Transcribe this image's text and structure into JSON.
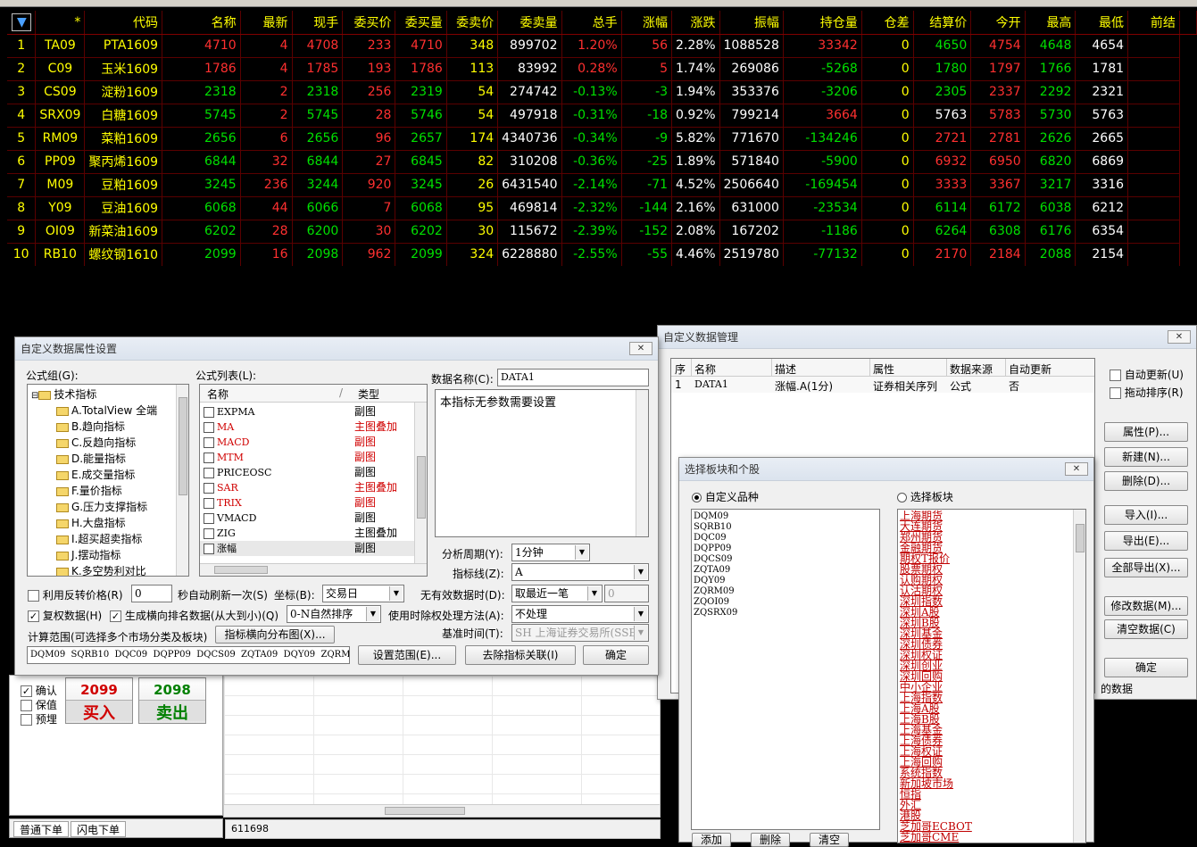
{
  "market": {
    "headers": [
      "*",
      "代码",
      "名称",
      "最新",
      "现手",
      "委买价",
      "委买量",
      "委卖价",
      "委卖量",
      "总手",
      "涨幅",
      "涨跌",
      "振幅",
      "持仓量",
      "仓差",
      "结算价",
      "今开",
      "最高",
      "最低",
      "前结"
    ],
    "sort_icon": "sort-arrow-icon",
    "rows": [
      [
        "1",
        "TA09",
        "PTA1609",
        "4710",
        "4",
        "4708",
        "233",
        "4710",
        "348",
        "899702",
        "1.20%",
        "56",
        "2.28%",
        "1088528",
        "33342",
        "0",
        "4650",
        "4754",
        "4648",
        "4654"
      ],
      [
        "2",
        "C09",
        "玉米1609",
        "1786",
        "4",
        "1785",
        "193",
        "1786",
        "113",
        "83992",
        "0.28%",
        "5",
        "1.74%",
        "269086",
        "-5268",
        "0",
        "1780",
        "1797",
        "1766",
        "1781"
      ],
      [
        "3",
        "CS09",
        "淀粉1609",
        "2318",
        "2",
        "2318",
        "256",
        "2319",
        "54",
        "274742",
        "-0.13%",
        "-3",
        "1.94%",
        "353376",
        "-3206",
        "0",
        "2305",
        "2337",
        "2292",
        "2321"
      ],
      [
        "4",
        "SRX09",
        "白糖1609",
        "5745",
        "2",
        "5745",
        "28",
        "5746",
        "54",
        "497918",
        "-0.31%",
        "-18",
        "0.92%",
        "799214",
        "3664",
        "0",
        "5763",
        "5783",
        "5730",
        "5763"
      ],
      [
        "5",
        "RM09",
        "菜粕1609",
        "2656",
        "6",
        "2656",
        "96",
        "2657",
        "174",
        "4340736",
        "-0.34%",
        "-9",
        "5.82%",
        "771670",
        "-134246",
        "0",
        "2721",
        "2781",
        "2626",
        "2665"
      ],
      [
        "6",
        "PP09",
        "聚丙烯1609",
        "6844",
        "32",
        "6844",
        "27",
        "6845",
        "82",
        "310208",
        "-0.36%",
        "-25",
        "1.89%",
        "571840",
        "-5900",
        "0",
        "6932",
        "6950",
        "6820",
        "6869"
      ],
      [
        "7",
        "M09",
        "豆粕1609",
        "3245",
        "236",
        "3244",
        "920",
        "3245",
        "26",
        "6431540",
        "-2.14%",
        "-71",
        "4.52%",
        "2506640",
        "-169454",
        "0",
        "3333",
        "3367",
        "3217",
        "3316"
      ],
      [
        "8",
        "Y09",
        "豆油1609",
        "6068",
        "44",
        "6066",
        "7",
        "6068",
        "95",
        "469814",
        "-2.32%",
        "-144",
        "2.16%",
        "631000",
        "-23534",
        "0",
        "6114",
        "6172",
        "6038",
        "6212"
      ],
      [
        "9",
        "OI09",
        "新菜油1609",
        "6202",
        "28",
        "6200",
        "30",
        "6202",
        "30",
        "115672",
        "-2.39%",
        "-152",
        "2.08%",
        "167202",
        "-1186",
        "0",
        "6264",
        "6308",
        "6176",
        "6354"
      ],
      [
        "10",
        "RB10",
        "螺纹钢1610",
        "2099",
        "16",
        "2098",
        "962",
        "2099",
        "324",
        "6228880",
        "-2.55%",
        "-55",
        "4.46%",
        "2519780",
        "-77132",
        "0",
        "2170",
        "2184",
        "2088",
        "2154"
      ]
    ]
  },
  "order": {
    "confirm": "确认",
    "hedge": "保值",
    "preorder": "预埋",
    "buy_price": "2099",
    "buy_label": "买入",
    "sell_price": "2098",
    "sell_label": "卖出",
    "tab_normal": "普通下单",
    "tab_flash": "闪电下单",
    "status_value": "611698"
  },
  "prop_dialog": {
    "title": "自定义数据属性设置",
    "group_label": "公式组(G):",
    "list_label": "公式列表(L):",
    "name_label": "数据名称(C):",
    "name_value": "DATA1",
    "desc": "本指标无参数需要设置",
    "tree_root": "技术指标",
    "tree": [
      "A.TotalView 全端",
      "B.趋向指标",
      "C.反趋向指标",
      "D.能量指标",
      "E.成交量指标",
      "F.量价指标",
      "G.压力支撑指标",
      "H.大盘指标",
      "I.超买超卖指标",
      "J.摆动指标",
      "K.多空势利对比"
    ],
    "col_name": "名称",
    "col_type": "类型",
    "formulas": [
      {
        "name": "EXPMA",
        "type": "副图",
        "red": false
      },
      {
        "name": "MA",
        "type": "主图叠加",
        "red": true
      },
      {
        "name": "MACD",
        "type": "副图",
        "red": true
      },
      {
        "name": "MTM",
        "type": "副图",
        "red": true
      },
      {
        "name": "PRICEOSC",
        "type": "副图",
        "red": false
      },
      {
        "name": "SAR",
        "type": "主图叠加",
        "red": true
      },
      {
        "name": "TRIX",
        "type": "副图",
        "red": true
      },
      {
        "name": "VMACD",
        "type": "副图",
        "red": false
      },
      {
        "name": "ZIG",
        "type": "主图叠加",
        "red": false
      },
      {
        "name": "涨幅",
        "type": "副图",
        "red": false
      }
    ],
    "period_label": "分析周期(Y):",
    "period_value": "1分钟",
    "line_label": "指标线(Z):",
    "line_value": "A",
    "reverse_label": "利用反转价格(R)",
    "reverse_value": "0",
    "refresh_label": "秒自动刷新一次(S)",
    "axis_label": "坐标(B):",
    "axis_value": "交易日",
    "invalid_label": "无有效数据时(D):",
    "invalid_value": "取最近一笔",
    "invalid_num": "0",
    "adjust_label": "复权数据(H)",
    "rank_label": "生成横向排名数据(从大到小)(Q)",
    "rank_value": "0-N自然排序",
    "exright_label": "使用时除权处理方法(A):",
    "exright_value": "不处理",
    "range_label": "计算范围(可选择多个市场分类及板块)",
    "dist_btn": "指标横向分布图(X)...",
    "base_label": "基准时间(T):",
    "base_value": "SH 上海证券交易所(SSE)",
    "range_codes": "DQM09  SQRB10  DQC09  DQPP09  DQCS09  ZQTA09  DQY09  ZQRM09",
    "set_range_btn": "设置范围(E)...",
    "remove_btn": "去除指标关联(I)",
    "ok_btn": "确定"
  },
  "mgmt_dialog": {
    "title": "自定义数据管理",
    "cols": [
      "序",
      "名称",
      "描述",
      "属性",
      "数据来源",
      "自动更新"
    ],
    "row": [
      "1",
      "DATA1",
      "涨幅.A(1分)",
      "证券相关序列",
      "公式",
      "否"
    ],
    "auto_update": "自动更新(U)",
    "drag_sort": "拖动排序(R)",
    "btn_props": "属性(P)...",
    "btn_new": "新建(N)...",
    "btn_delete": "删除(D)...",
    "btn_import": "导入(I)...",
    "btn_export": "导出(E)...",
    "btn_export_all": "全部导出(X)...",
    "btn_modify": "修改数据(M)...",
    "btn_clear": "清空数据(C)",
    "btn_ok": "确定",
    "footer_text": "的数据"
  },
  "select_dialog": {
    "title": "选择板块和个股",
    "radio_custom": "自定义品种",
    "radio_block": "选择板块",
    "codes": [
      "DQM09",
      "SQRB10",
      "DQC09",
      "DQPP09",
      "DQCS09",
      "ZQTA09",
      "DQY09",
      "ZQRM09",
      "ZQOI09",
      "ZQSRX09"
    ],
    "blocks": [
      "上海期货",
      "大连期货",
      "郑州期货",
      "金融期货",
      "期权T报价",
      "股票期权",
      "认购期权",
      "认沽期权",
      "深圳指数",
      "深圳A股",
      "深圳B股",
      "深圳基金",
      "深圳债券",
      "深圳权证",
      "深圳创业",
      "深圳回购",
      "中小企业",
      "上海指数",
      "上海A股",
      "上海B股",
      "上海基金",
      "上海债券",
      "上海权证",
      "上海回购",
      "系统指数",
      "新加坡市场",
      "恒指",
      "外汇",
      "港股",
      "芝加哥ECBOT",
      "芝加哥CME"
    ],
    "btn_add": "添加",
    "btn_delete": "删除",
    "btn_clear": "清空"
  }
}
